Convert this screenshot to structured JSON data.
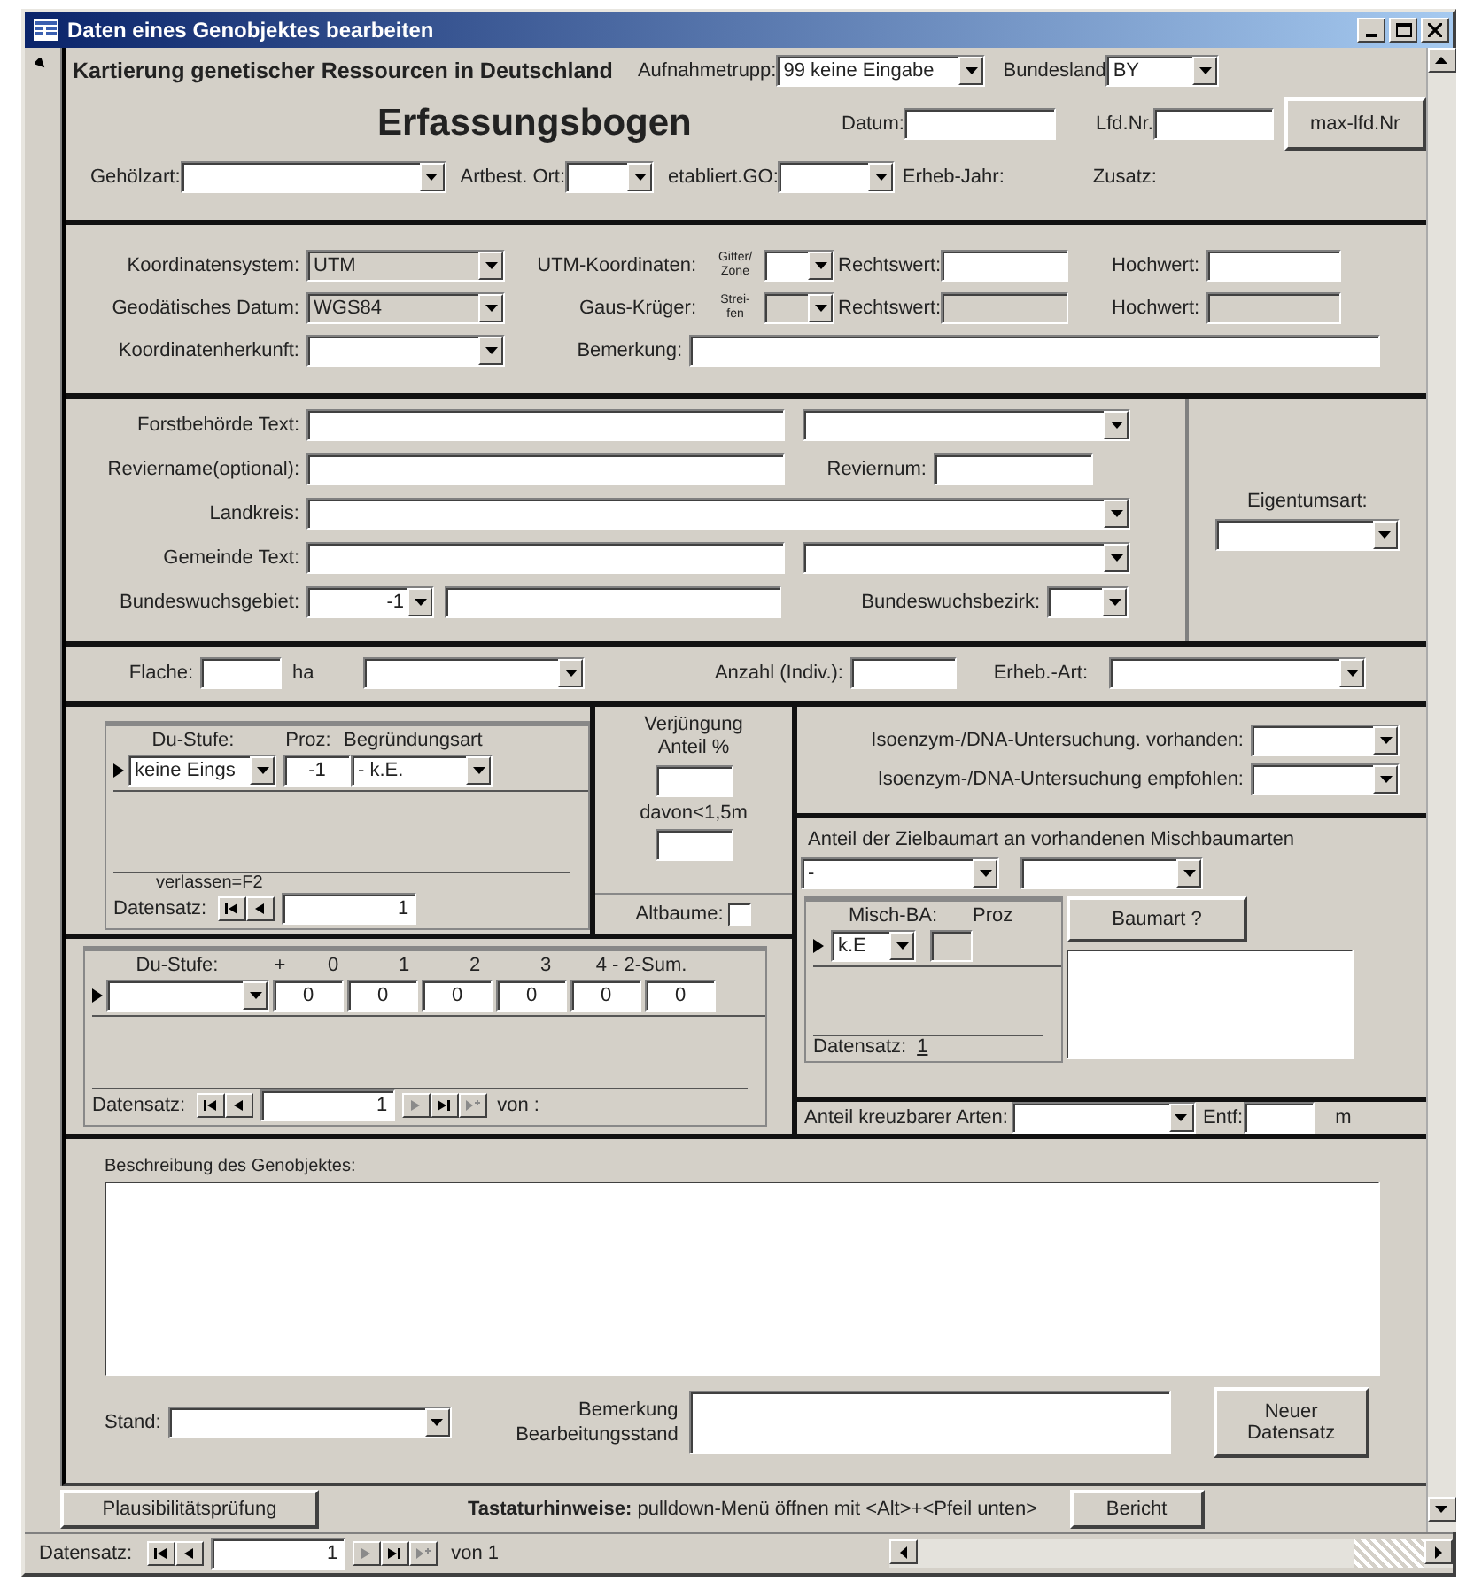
{
  "window": {
    "title": "Daten eines Genobjektes bearbeiten"
  },
  "header": {
    "project": "Kartierung genetischer Ressourcen in Deutschland",
    "form_title": "Erfassungsbogen",
    "aufnahmetrupp": {
      "label": "Aufnahmetrupp:",
      "value": "99 keine Eingabe"
    },
    "bundesland": {
      "label": "Bundesland",
      "value": "BY"
    },
    "datum": {
      "label": "Datum:"
    },
    "lfd_nr": {
      "label": "Lfd.Nr."
    },
    "max_button": "max-lfd.Nr",
    "gehoelzart": {
      "label": "Gehölzart:"
    },
    "artbest_ort": {
      "label": "Artbest. Ort:"
    },
    "etabliert_go": {
      "label": "etabliert.GO:"
    },
    "erheb_jahr": {
      "label": "Erheb-Jahr:"
    },
    "zusatz": {
      "label": "Zusatz:"
    }
  },
  "coordinates": {
    "system": {
      "label": "Koordinatensystem:",
      "value": "UTM",
      "disabled": true
    },
    "datum": {
      "label": "Geodätisches Datum:",
      "value": "WGS84",
      "disabled": true
    },
    "herkunft": {
      "label": "Koordinatenherkunft:"
    },
    "utm": {
      "label": "UTM-Koordinaten:",
      "zone_label": "Gitter/ Zone",
      "rechtswert": "Rechtswert:",
      "hochwert": "Hochwert:",
      "disabled": false
    },
    "gauss": {
      "label": "Gaus-Krüger:",
      "zone_label": "Strei- fen",
      "rechtswert": "Rechtswert:",
      "hochwert": "Hochwert:",
      "disabled": true
    },
    "bemerkung": {
      "label": "Bemerkung:"
    }
  },
  "administration": {
    "forstbehoerde": {
      "label": "Forstbehörde Text:"
    },
    "reviername": {
      "label": "Reviername(optional):"
    },
    "reviernum": {
      "label": "Reviernum:"
    },
    "landkreis": {
      "label": "Landkreis:"
    },
    "gemeinde": {
      "label": "Gemeinde Text:"
    },
    "bundeswuchsgebiet": {
      "label": "Bundeswuchsgebiet:",
      "value": "-1"
    },
    "bundeswuchsbezirk": {
      "label": "Bundeswuchsbezirk:"
    },
    "eigentumsart": {
      "label": "Eigentumsart:"
    }
  },
  "area": {
    "flaeche": {
      "label": "Flache:",
      "unit": "ha"
    },
    "anzahl": {
      "label": "Anzahl (Indiv.):"
    },
    "erheb_art": {
      "label": "Erheb.-Art:"
    }
  },
  "damage": {
    "columns": [
      "Du-Stufe:",
      "Proz:",
      "Begründungsart"
    ],
    "row": [
      "keine Eings",
      "-1",
      "- k.E."
    ],
    "note": "verlassen=F2",
    "nav_label": "Datensatz:",
    "record": "1"
  },
  "regeneration": {
    "label": "Verjüngung Anteil %",
    "below_label": "davon<1,5m",
    "altbaeume": {
      "label": "Altbaume:",
      "checked": false
    }
  },
  "damage_sum": {
    "columns": [
      "Du-Stufe:",
      "+",
      "0",
      "1",
      "2",
      "3",
      "4 - 2-Sum."
    ],
    "values": [
      "0",
      "0",
      "0",
      "0",
      "0",
      "0"
    ],
    "nav_label": "Datensatz:",
    "record": "1",
    "total": "von :"
  },
  "isoenzym": {
    "vorhanden": {
      "label": "Isoenzym-/DNA-Untersuchung. vorhanden:"
    },
    "empfohlen": {
      "label": "Isoenzym-/DNA-Untersuchung empfohlen:"
    }
  },
  "mixture": {
    "label": "Anteil der Zielbaumart an vorhandenen Mischbaumarten",
    "share": {
      "value": "-"
    },
    "columns": [
      "Misch-BA:",
      "Proz"
    ],
    "row": [
      "k.E"
    ],
    "nav_label": "Datensatz:",
    "record": "1",
    "button": "Baumart ?"
  },
  "crossable": {
    "label": "Anteil kreuzbarer Arten:",
    "distance_label": "Entf:",
    "unit": "m"
  },
  "description": {
    "label": "Beschreibung des Genobjektes:",
    "stand": {
      "label": "Stand:"
    },
    "remark_label": "Bemerkung Bearbeitungsstand",
    "new_button": "Neuer Datensatz"
  },
  "footer": {
    "check_button": "Plausibilitätsprüfung",
    "hint": "**Tastaturhinweise:** pulldown-Menü öffnen mit <Alt>+<Pfeil unten>",
    "report_button": "Bericht"
  },
  "record_nav": {
    "label": "Datensatz:",
    "record": "1",
    "total": "von 1"
  }
}
